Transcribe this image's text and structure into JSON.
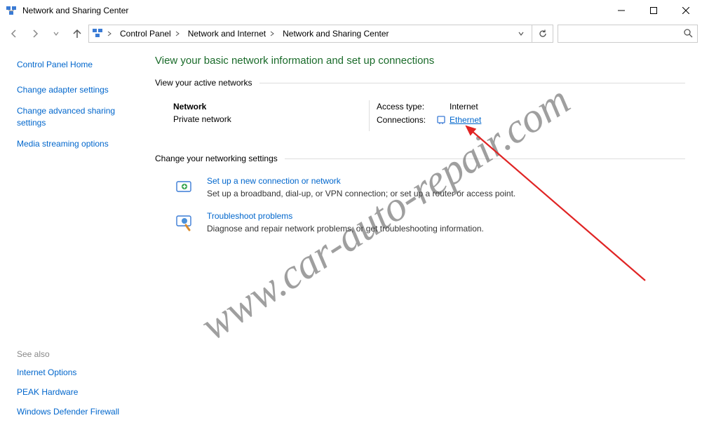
{
  "window": {
    "title": "Network and Sharing Center"
  },
  "breadcrumb": {
    "items": [
      "Control Panel",
      "Network and Internet",
      "Network and Sharing Center"
    ]
  },
  "sidebar": {
    "home": "Control Panel Home",
    "links": [
      "Change adapter settings",
      "Change advanced sharing settings",
      "Media streaming options"
    ],
    "seealso_header": "See also",
    "seealso": [
      "Internet Options",
      "PEAK Hardware",
      "Windows Defender Firewall"
    ]
  },
  "main": {
    "heading": "View your basic network information and set up connections",
    "active_networks_header": "View your active networks",
    "network": {
      "name": "Network",
      "type": "Private network",
      "access_label": "Access type:",
      "access_value": "Internet",
      "conn_label": "Connections:",
      "conn_value": "Ethernet"
    },
    "change_settings_header": "Change your networking settings",
    "settings": [
      {
        "title": "Set up a new connection or network",
        "desc": "Set up a broadband, dial-up, or VPN connection; or set up a router or access point."
      },
      {
        "title": "Troubleshoot problems",
        "desc": "Diagnose and repair network problems, or get troubleshooting information."
      }
    ]
  },
  "watermark": "www.car-auto-repair.com"
}
